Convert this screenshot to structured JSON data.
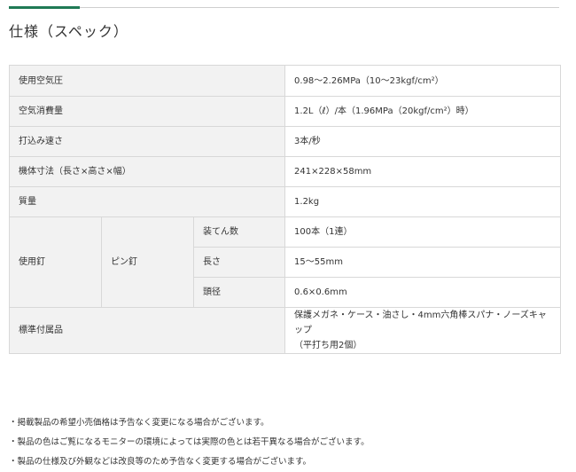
{
  "section": {
    "title": "仕様（スペック）"
  },
  "specs": {
    "pressure": {
      "label": "使用空気圧",
      "value": "0.98〜2.26MPa（10〜23kgf/cm²）"
    },
    "air": {
      "label": "空気消費量",
      "value": "1.2L（ℓ）/本（1.96MPa（20kgf/cm²）時）"
    },
    "speed": {
      "label": "打込み速さ",
      "value": "3本/秒"
    },
    "dims": {
      "label": "機体寸法（長さ×高さ×幅）",
      "value": "241×228×58mm"
    },
    "mass": {
      "label": "質量",
      "value": "1.2kg"
    },
    "nail": {
      "label": "使用釘",
      "type": "ピン釘",
      "capacity": {
        "label": "装てん数",
        "value": "100本（1連）"
      },
      "length": {
        "label": "長さ",
        "value": "15〜55mm"
      },
      "diameter": {
        "label": "頭径",
        "value": "0.6×0.6mm"
      }
    },
    "accessories": {
      "label": "標準付属品",
      "value_line1": "保護メガネ・ケース・油さし・4mm六角棒スパナ・ノーズキャップ",
      "value_line2": "（平打ち用2個）"
    }
  },
  "notes": [
    "・掲載製品の希望小売価格は予告なく変更になる場合がございます。",
    "・製品の色はご覧になるモニターの環境によっては実際の色とは若干異なる場合がございます。",
    "・製品の仕様及び外観などは改良等のため予告なく変更する場合がございます。"
  ]
}
